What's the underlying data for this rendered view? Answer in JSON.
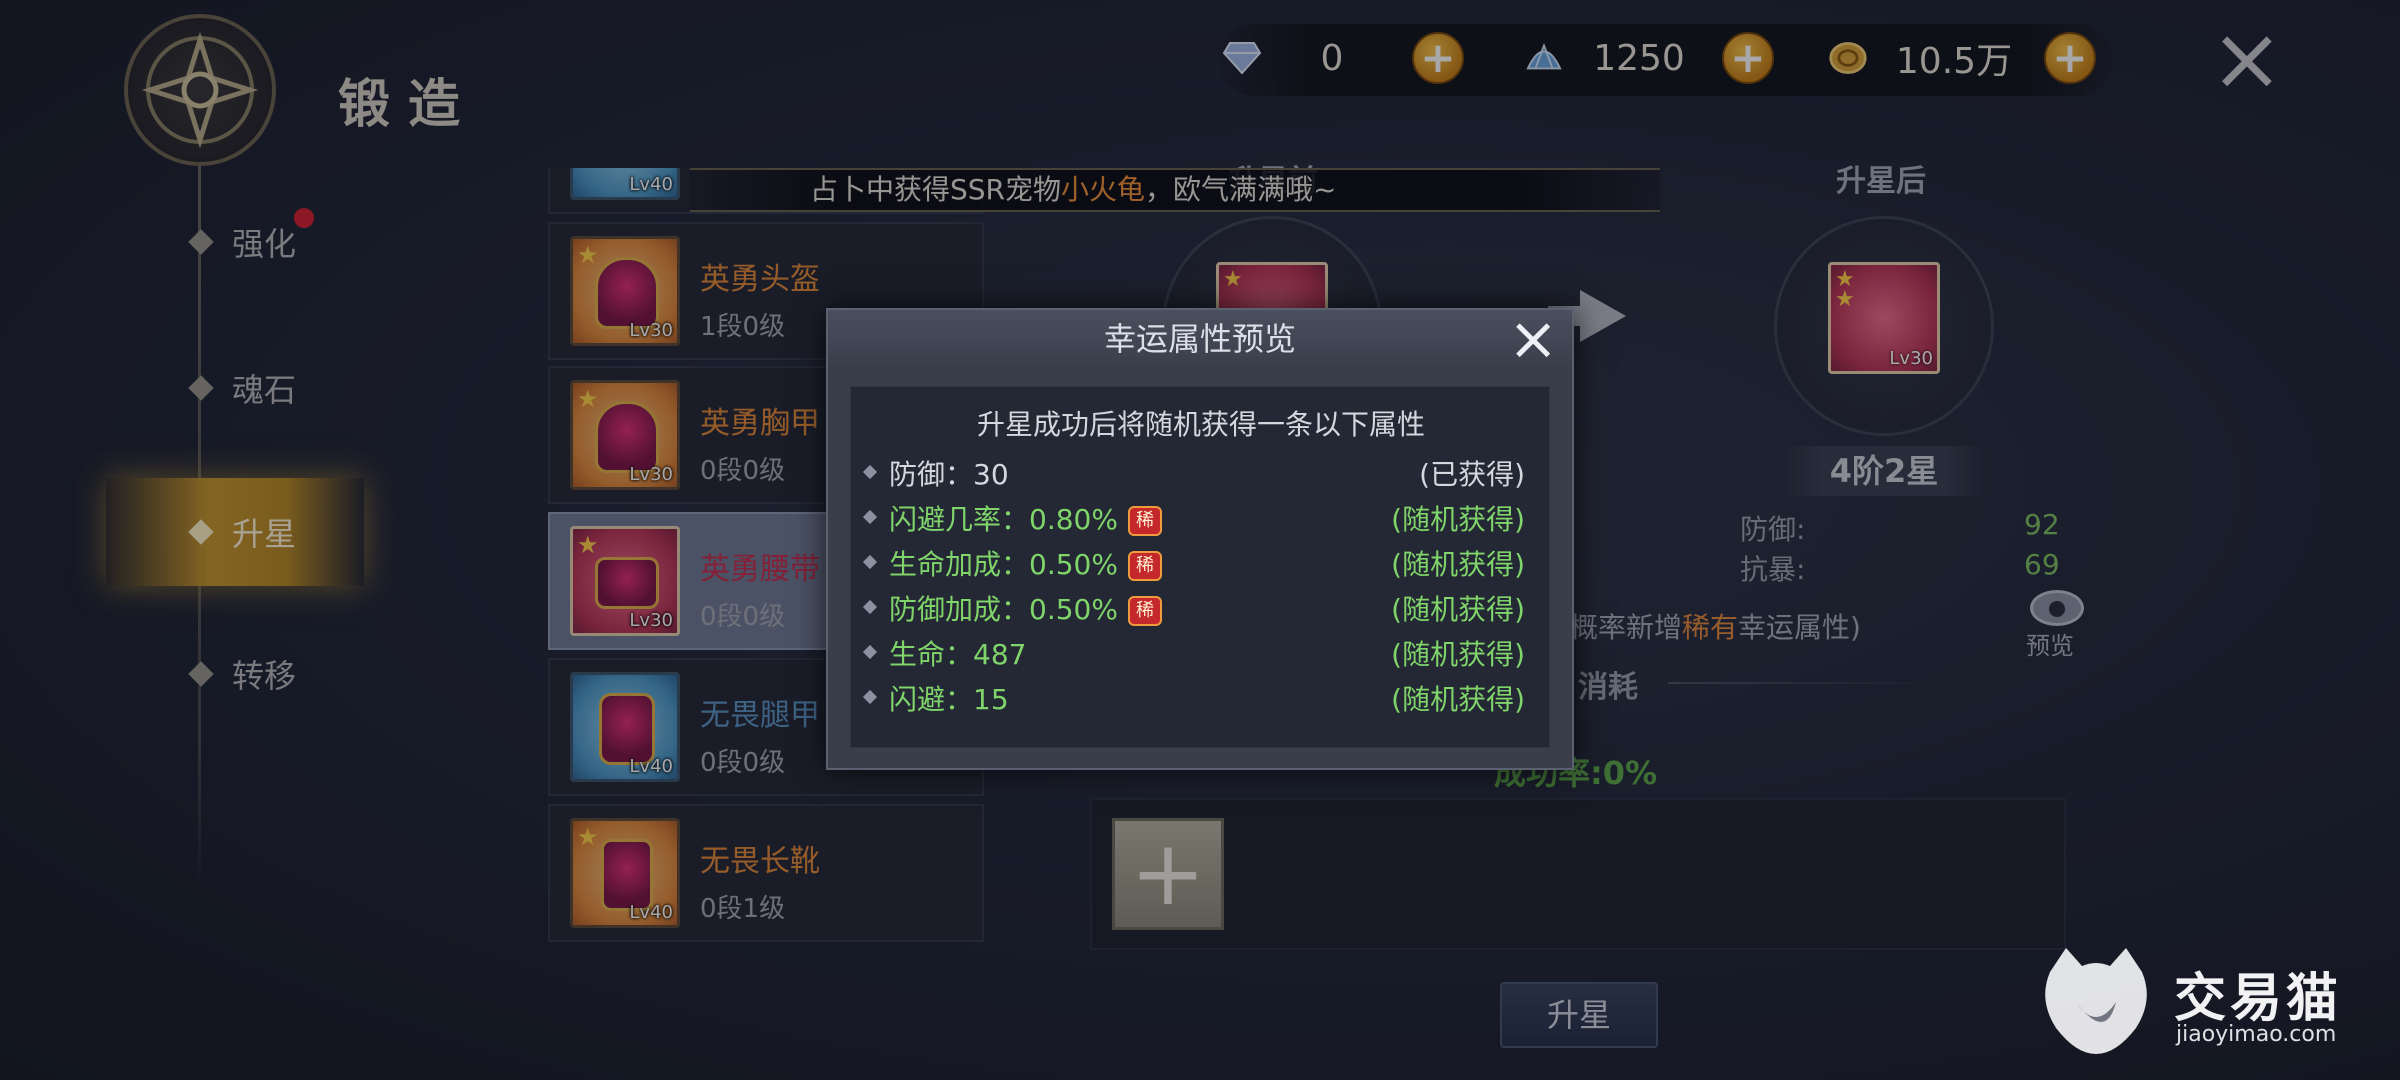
{
  "header": {
    "title": "锻造"
  },
  "nav": {
    "items": [
      {
        "label": "强化",
        "badge": true
      },
      {
        "label": "魂石"
      },
      {
        "label": "升星",
        "active": true
      },
      {
        "label": "转移"
      }
    ]
  },
  "currency": [
    {
      "icon": "diamond-icon",
      "value": "0"
    },
    {
      "icon": "shell-icon",
      "value": "1250"
    },
    {
      "icon": "gold-coin-icon",
      "value": "10.5万"
    }
  ],
  "marquee": {
    "prefix": "占卜中获得SSR宠物",
    "pet": "小火龟",
    "suffix": "，欧气满满哦~",
    "partial_item_level": "Lv40"
  },
  "items": [
    {
      "name": "英勇头盔",
      "level": "1段0级",
      "lv": "Lv30",
      "color": "orange"
    },
    {
      "name": "英勇胸甲",
      "level": "0段0级",
      "lv": "Lv30",
      "color": "orange"
    },
    {
      "name": "英勇腰带",
      "level": "0段0级",
      "lv": "Lv30",
      "color": "pink",
      "selected": true
    },
    {
      "name": "无畏腿甲",
      "level": "0段0级",
      "lv": "Lv40",
      "color": "blue"
    },
    {
      "name": "无畏长靴",
      "level": "0段1级",
      "lv": "Lv40",
      "color": "orange"
    }
  ],
  "upgrade": {
    "before_label": "升星前",
    "after_label": "升星后",
    "after_item_lv": "Lv30",
    "rank": "4阶2星",
    "stats": [
      {
        "name": "防御:",
        "value": "92"
      },
      {
        "name": "抗暴:",
        "value": "69"
      }
    ],
    "lucky_hint_pre": "概率新增",
    "lucky_hint_rare": "稀有",
    "lucky_hint_post": "幸运属性)",
    "preview_label": "预览",
    "consume_title": "消耗",
    "success_rate": "成功率:0%",
    "button_label": "升星"
  },
  "modal": {
    "title": "幸运属性预览",
    "subtitle": "升星成功后将随机获得一条以下属性",
    "attributes": [
      {
        "name": "防御：30",
        "status": "(已获得)",
        "owned": true,
        "rare": false
      },
      {
        "name": "闪避几率：0.80%",
        "status": "(随机获得)",
        "owned": false,
        "rare": true
      },
      {
        "name": "生命加成：0.50%",
        "status": "(随机获得)",
        "owned": false,
        "rare": true
      },
      {
        "name": "防御加成：0.50%",
        "status": "(随机获得)",
        "owned": false,
        "rare": true
      },
      {
        "name": "生命：487",
        "status": "(随机获得)",
        "owned": false,
        "rare": false
      },
      {
        "name": "闪避：15",
        "status": "(随机获得)",
        "owned": false,
        "rare": false
      }
    ],
    "rare_badge": "稀"
  },
  "watermark": {
    "brand": "交易猫",
    "url": "jiaoyimao.com"
  },
  "colors": {
    "accent_gold": "#c8982e",
    "rare_orange": "#e58a3c",
    "random_green": "#7fd46a"
  }
}
